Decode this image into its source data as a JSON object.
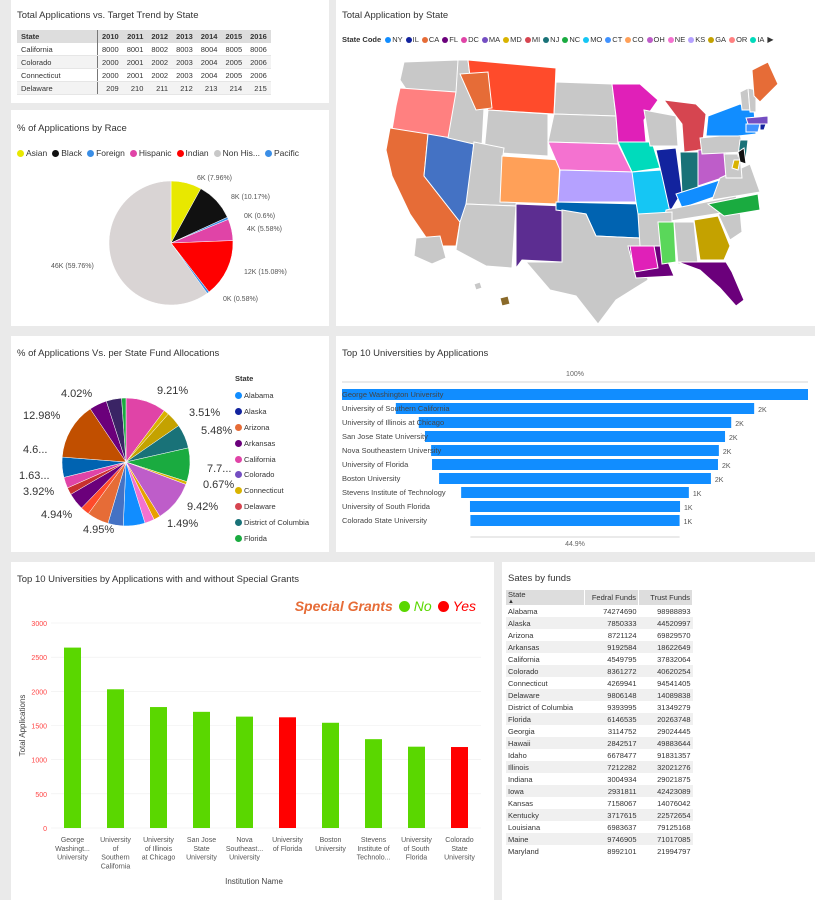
{
  "trend": {
    "title": "Total Applications vs. Target Trend by State",
    "header": [
      "State",
      "2010",
      "2011",
      "2012",
      "2013",
      "2014",
      "2015",
      "2016"
    ],
    "rows": [
      [
        "California",
        "8000",
        "8001",
        "8002",
        "8003",
        "8004",
        "8005",
        "8006"
      ],
      [
        "Colorado",
        "2000",
        "2001",
        "2002",
        "2003",
        "2004",
        "2005",
        "2006"
      ],
      [
        "Connecticut",
        "2000",
        "2001",
        "2002",
        "2003",
        "2004",
        "2005",
        "2006"
      ],
      [
        "Delaware",
        "209",
        "210",
        "211",
        "212",
        "213",
        "214",
        "215"
      ]
    ]
  },
  "map": {
    "title": "Total Application by State",
    "legend_title": "State Code",
    "legend": [
      {
        "label": "NY",
        "color": "#118dff"
      },
      {
        "label": "IL",
        "color": "#12239e"
      },
      {
        "label": "CA",
        "color": "#e66c37"
      },
      {
        "label": "FL",
        "color": "#6b007b"
      },
      {
        "label": "DC",
        "color": "#e044a7"
      },
      {
        "label": "MA",
        "color": "#744ec2"
      },
      {
        "label": "MD",
        "color": "#d9b300"
      },
      {
        "label": "MI",
        "color": "#d64550"
      },
      {
        "label": "NJ",
        "color": "#197278"
      },
      {
        "label": "NC",
        "color": "#1aab40"
      },
      {
        "label": "MO",
        "color": "#15c6f4"
      },
      {
        "label": "CT",
        "color": "#4092ff"
      },
      {
        "label": "CO",
        "color": "#ffa058"
      },
      {
        "label": "OH",
        "color": "#be5dc9"
      },
      {
        "label": "NE",
        "color": "#f472d0"
      },
      {
        "label": "KS",
        "color": "#b5a1ff"
      },
      {
        "label": "GA",
        "color": "#c4a200"
      },
      {
        "label": "OR",
        "color": "#ff8080"
      },
      {
        "label": "IA",
        "color": "#00dbbc"
      }
    ]
  },
  "race": {
    "title": "% of Applications by Race",
    "legend": [
      {
        "label": "Asian",
        "color": "#e8e800"
      },
      {
        "label": "Black",
        "color": "#111111"
      },
      {
        "label": "Foreign",
        "color": "#3a8ee6"
      },
      {
        "label": "Hispanic",
        "color": "#e044a7"
      },
      {
        "label": "Indian",
        "color": "#ff0000"
      },
      {
        "label": "Non His...",
        "color": "#c8c8c8"
      },
      {
        "label": "Pacific",
        "color": "#3a8ee6"
      }
    ],
    "labels": {
      "asian": "6K (7.96%)",
      "black": "8K (10.17%)",
      "foreign": "0K (0.6%)",
      "hispanic": "4K (5.58%)",
      "indian": "12K (15.08%)",
      "pacific": "0K (0.58%)",
      "nonhis": "46K (59.76%)"
    }
  },
  "fund_alloc": {
    "title": "% of Applications Vs. per State Fund Allocations",
    "legend_title": "State",
    "legend": [
      {
        "label": "Alabama",
        "color": "#118dff"
      },
      {
        "label": "Alaska",
        "color": "#12239e"
      },
      {
        "label": "Arizona",
        "color": "#e66c37"
      },
      {
        "label": "Arkansas",
        "color": "#6b007b"
      },
      {
        "label": "California",
        "color": "#e044a7"
      },
      {
        "label": "Colorado",
        "color": "#744ec2"
      },
      {
        "label": "Connecticut",
        "color": "#d9b300"
      },
      {
        "label": "Delaware",
        "color": "#d64550"
      },
      {
        "label": "District of Columbia",
        "color": "#197278"
      },
      {
        "label": "Florida",
        "color": "#1aab40"
      }
    ],
    "labels": {
      "l921": "9.21%",
      "l351": "3.51%",
      "l548": "5.48%",
      "l77": "7.7...",
      "l067": "0.67%",
      "l942": "9.42%",
      "l149": "1.49%",
      "l495": "4.95%",
      "l494": "4.94%",
      "l392": "3.92%",
      "l163": "1.63...",
      "l46": "4.6...",
      "l1298": "12.98%",
      "l402": "4.02%"
    }
  },
  "top10": {
    "title": "Top 10 Universities by Applications",
    "top_pct": "100%",
    "bottom_pct": "44.9%",
    "items": [
      {
        "name": "George Washington University",
        "value": 2640,
        "label": ""
      },
      {
        "name": "University of Southern California",
        "value": 2030,
        "label": "2K"
      },
      {
        "name": "University of Illinois at Chicago",
        "value": 1770,
        "label": "2K"
      },
      {
        "name": "San Jose State University",
        "value": 1700,
        "label": "2K"
      },
      {
        "name": "Nova Southeastern University",
        "value": 1630,
        "label": "2K"
      },
      {
        "name": "University of Florida",
        "value": 1620,
        "label": "2K"
      },
      {
        "name": "Boston University",
        "value": 1540,
        "label": "2K"
      },
      {
        "name": "Stevens Institute of Technology",
        "value": 1290,
        "label": "1K"
      },
      {
        "name": "University of South Florida",
        "value": 1190,
        "label": "1K"
      },
      {
        "name": "Colorado State University",
        "value": 1185,
        "label": "1K"
      }
    ]
  },
  "chart_data": {
    "type": "bar",
    "title": "Top 10 Universities by Applications with and without Special Grants",
    "xlabel": "Institution Name",
    "ylabel": "Total Applications",
    "ylim": [
      0,
      3000
    ],
    "yticks": [
      "0",
      "500",
      "1000",
      "1500",
      "2000",
      "2500",
      "3000"
    ],
    "legend_title": "Special Grants",
    "legend": [
      {
        "label": "No",
        "color": "#5ad700"
      },
      {
        "label": "Yes",
        "color": "#ff0000"
      }
    ],
    "categories": [
      [
        "George",
        "Washingt...",
        "University"
      ],
      [
        "University",
        "of",
        "Southern",
        "California"
      ],
      [
        "University",
        "of Illinois",
        "at Chicago"
      ],
      [
        "San Jose",
        "State",
        "University"
      ],
      [
        "Nova",
        "Southeast...",
        "University"
      ],
      [
        "University",
        "of Florida"
      ],
      [
        "Boston",
        "University"
      ],
      [
        "Stevens",
        "Institute of",
        "Technolo..."
      ],
      [
        "University",
        "of South",
        "Florida"
      ],
      [
        "Colorado",
        "State",
        "University"
      ]
    ],
    "values": [
      2640,
      2030,
      1770,
      1700,
      1630,
      1620,
      1540,
      1300,
      1190,
      1185
    ],
    "special_grant": [
      "No",
      "No",
      "No",
      "No",
      "No",
      "Yes",
      "No",
      "No",
      "No",
      "Yes"
    ]
  },
  "funds": {
    "title": "Sates by funds",
    "header": [
      "State",
      "Fedral Funds",
      "Trust Funds"
    ],
    "rows": [
      [
        "Alabama",
        "74274690",
        "98988893"
      ],
      [
        "Alaska",
        "7850333",
        "44520997"
      ],
      [
        "Arizona",
        "8721124",
        "69829570"
      ],
      [
        "Arkansas",
        "9192584",
        "18622649"
      ],
      [
        "California",
        "4549795",
        "37832064"
      ],
      [
        "Colorado",
        "8361272",
        "40620254"
      ],
      [
        "Connecticut",
        "4269941",
        "94541405"
      ],
      [
        "Delaware",
        "9806148",
        "14089838"
      ],
      [
        "District of Columbia",
        "9393995",
        "31349279"
      ],
      [
        "Florida",
        "6146535",
        "20263748"
      ],
      [
        "Georgia",
        "3114752",
        "29024445"
      ],
      [
        "Hawaii",
        "2842517",
        "49883644"
      ],
      [
        "Idaho",
        "6678477",
        "91831357"
      ],
      [
        "Illinois",
        "7212282",
        "32021276"
      ],
      [
        "Indiana",
        "3004934",
        "29021875"
      ],
      [
        "Iowa",
        "2931811",
        "42423089"
      ],
      [
        "Kansas",
        "7158067",
        "14076042"
      ],
      [
        "Kentucky",
        "3717615",
        "22572654"
      ],
      [
        "Louisiana",
        "6983637",
        "79125168"
      ],
      [
        "Maine",
        "9746905",
        "71017085"
      ],
      [
        "Maryland",
        "8992101",
        "21994797"
      ]
    ]
  }
}
